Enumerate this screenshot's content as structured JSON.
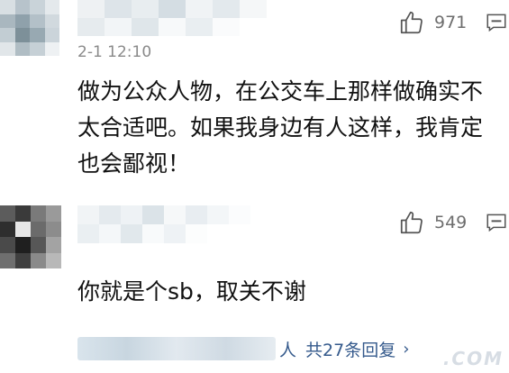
{
  "comments": [
    {
      "timestamp": "2-1 12:10",
      "likes": "971",
      "text": "做为公众人物，在公交车上那样做确实不太合适吧。如果我身边有人这样，我肯定也会鄙视！"
    },
    {
      "likes": "549",
      "text": "你就是个sb，取关不谢",
      "replies_suffix": "人",
      "replies_link": "共27条回复",
      "replies_chevron": "›"
    }
  ],
  "icons": {
    "like": "thumbs-up-outline-icon",
    "reply": "comment-bubble-icon",
    "chevron": "chevron-right-icon"
  },
  "colors": {
    "link": "#355a8c",
    "secondary_text": "#8a8a8a",
    "count_text": "#6e6e6e"
  },
  "watermark": ".COM"
}
